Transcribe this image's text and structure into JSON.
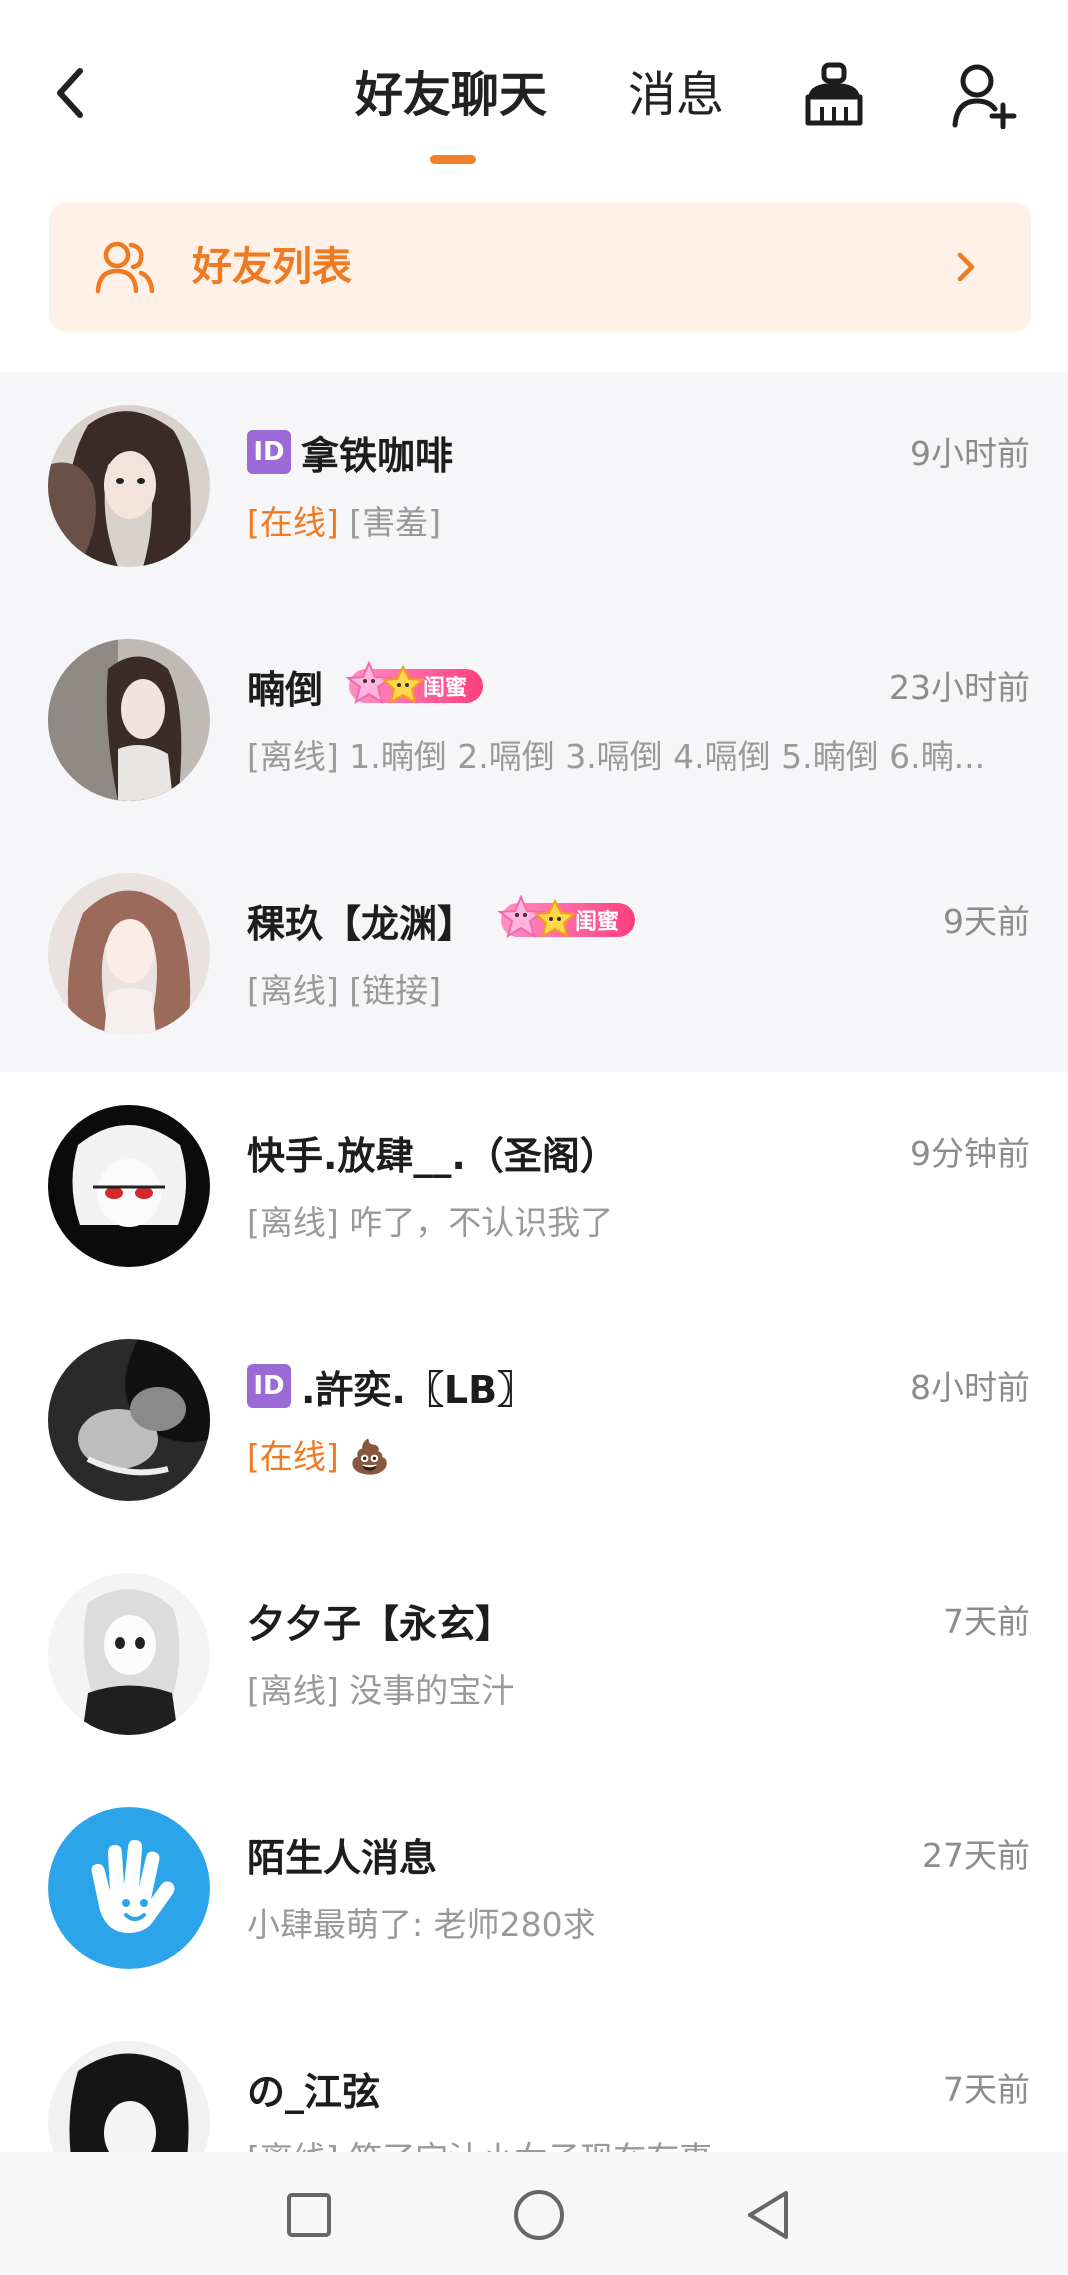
{
  "header": {
    "tabs": [
      {
        "label": "好友聊天",
        "active": true
      },
      {
        "label": "消息",
        "active": false
      }
    ],
    "icons": [
      "back-icon",
      "broom-clean-icon",
      "add-user-icon"
    ],
    "accent_color": "#f0802a"
  },
  "friend_list": {
    "label": "好友列表",
    "icon": "users-icon"
  },
  "conversations": [
    {
      "id_badge": "ID",
      "name": "拿铁咖啡",
      "time": "9小时前",
      "status": "[在线]",
      "status_type": "online",
      "message": "[害羞]",
      "pinned": true
    },
    {
      "name": "暔倒",
      "badge": "闺蜜",
      "time": "23小时前",
      "status": "[离线]",
      "status_type": "offline",
      "message": "1.暔倒 2.嗝倒 3.嗝倒 4.嗝倒 5.暔倒 6.暔...",
      "pinned": true
    },
    {
      "name": "稞玖【龙渊】",
      "badge": "闺蜜",
      "time": "9天前",
      "status": "[离线]",
      "status_type": "offline",
      "message": "[链接]",
      "pinned": true
    },
    {
      "name": "快手.放肆__.（圣阁）",
      "time": "9分钟前",
      "status": "[离线]",
      "status_type": "offline",
      "message": "咋了，不认识我了",
      "pinned": false
    },
    {
      "id_badge": "ID",
      "name": ".許奕.〖LB〗",
      "time": "8小时前",
      "status": "[在线]",
      "status_type": "online",
      "message": "💩",
      "pinned": false
    },
    {
      "name": "夕夕子【永玄】",
      "time": "7天前",
      "status": "[离线]",
      "status_type": "offline",
      "message": "没事的宝汁",
      "pinned": false
    },
    {
      "name": "陌生人消息",
      "time": "27天前",
      "status": "",
      "status_type": "none",
      "message": "小肆最萌了: 老师280求",
      "pinned": false
    },
    {
      "name": "の_江弦",
      "time": "7天前",
      "status": "[离线]",
      "status_type": "offline",
      "message": "笑了宝汁小女子现在有事",
      "pinned": false
    }
  ],
  "system_nav": [
    "recent-apps-icon",
    "home-icon",
    "back-triangle-icon"
  ]
}
